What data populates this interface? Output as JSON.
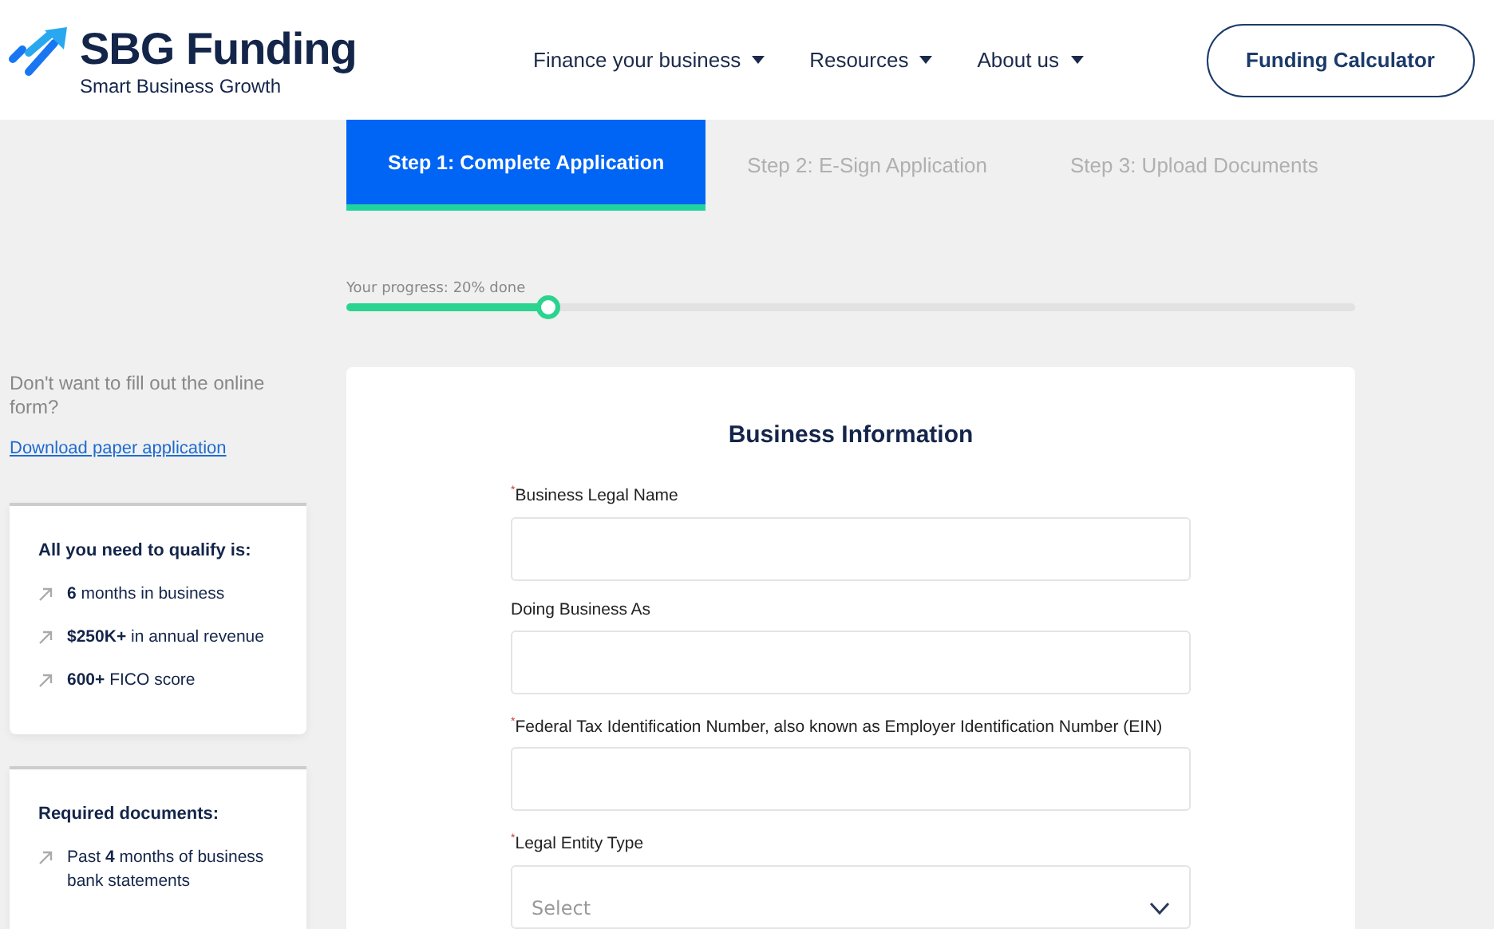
{
  "header": {
    "brand": "SBG Funding",
    "tagline": "Smart Business Growth",
    "nav": [
      {
        "label": "Finance your business"
      },
      {
        "label": "Resources"
      },
      {
        "label": "About us"
      }
    ],
    "cta": "Funding Calculator"
  },
  "steps": [
    {
      "label": "Step 1:  Complete Application",
      "selected": true
    },
    {
      "label": "Step 2:  E-Sign Application",
      "selected": false
    },
    {
      "label": "Step 3:  Upload Documents",
      "selected": false
    }
  ],
  "progress": {
    "label": "Your progress: 20% done",
    "level": 0.2
  },
  "sidebar": {
    "prompt": "Don't want to fill out the online form?",
    "link": "Download paper application",
    "cards": [
      {
        "title": "All you need to qualify is:",
        "items": [
          "**6** months in business",
          "**$250K+** in annual revenue",
          "**600+** FICO score"
        ]
      },
      {
        "title": "Required documents:",
        "items": [
          "Past **4** months of business bank statements"
        ]
      }
    ]
  },
  "form": {
    "title": "Business Information",
    "fields": [
      {
        "kind": "text",
        "label": "$^{*}$Business Legal Name"
      },
      {
        "kind": "text",
        "label": "Doing Business As"
      },
      {
        "kind": "text",
        "label": "$^{*}$Federal Tax Identification Number, also known as Employer Identification Number (EIN)"
      },
      {
        "kind": "select",
        "label": "$^{*}$Legal Entity Type",
        "placeholder": "Select"
      }
    ]
  }
}
